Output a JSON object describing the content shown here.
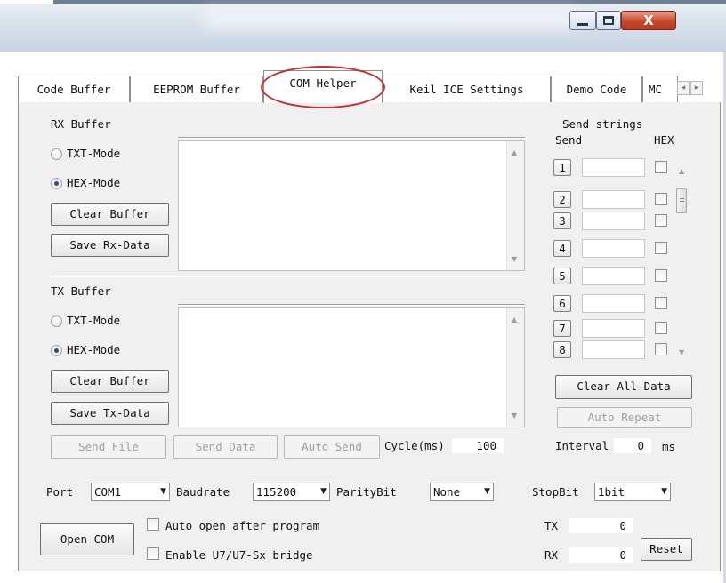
{
  "window": {
    "minimize_glyph": "minimize-icon",
    "maximize_glyph": "maximize-icon",
    "close_glyph": "X"
  },
  "tabs": [
    {
      "label": "Code Buffer"
    },
    {
      "label": "EEPROM Buffer"
    },
    {
      "label": "COM Helper",
      "active": true
    },
    {
      "label": "Keil ICE Settings"
    },
    {
      "label": "Demo Code"
    },
    {
      "label": "MC"
    }
  ],
  "tab_scroll": {
    "left": "◂",
    "right": "▸"
  },
  "highlight_color": "#d32a2a",
  "rx": {
    "title": "RX Buffer",
    "txt_mode": "TXT-Mode",
    "hex_mode": "HEX-Mode",
    "selected": "HEX-Mode",
    "clear": "Clear Buffer",
    "save": "Save Rx-Data"
  },
  "tx": {
    "title": "TX Buffer",
    "txt_mode": "TXT-Mode",
    "hex_mode": "HEX-Mode",
    "selected": "HEX-Mode",
    "clear": "Clear Buffer",
    "save": "Save Tx-Data"
  },
  "tx_actions": {
    "send_file": "Send File",
    "send_data": "Send Data",
    "auto_send": "Auto Send",
    "cycle_label": "Cycle(ms)",
    "cycle_value": "100"
  },
  "send_strings": {
    "title": "Send strings",
    "send_header": "Send",
    "hex_header": "HEX",
    "rows": [
      {
        "num": "1",
        "value": ""
      },
      {
        "num": "2",
        "value": ""
      },
      {
        "num": "3",
        "value": ""
      },
      {
        "num": "4",
        "value": ""
      },
      {
        "num": "5",
        "value": ""
      },
      {
        "num": "6",
        "value": ""
      },
      {
        "num": "7",
        "value": ""
      },
      {
        "num": "8",
        "value": ""
      }
    ],
    "clear_all": "Clear All Data",
    "auto_repeat": "Auto Repeat",
    "interval_label": "Interval",
    "interval_value": "0",
    "interval_unit": "ms"
  },
  "settings": {
    "port_label": "Port",
    "port_value": "COM1",
    "baud_label": "Baudrate",
    "baud_value": "115200",
    "parity_label": "ParityBit",
    "parity_value": "None",
    "stop_label": "StopBit",
    "stop_value": "1bit",
    "open_com": "Open COM",
    "auto_open": "Auto open after program",
    "bridge": "Enable U7/U7-Sx bridge",
    "tx_label": "TX",
    "tx_count": "0",
    "rx_label": "RX",
    "rx_count": "0",
    "reset": "Reset"
  }
}
